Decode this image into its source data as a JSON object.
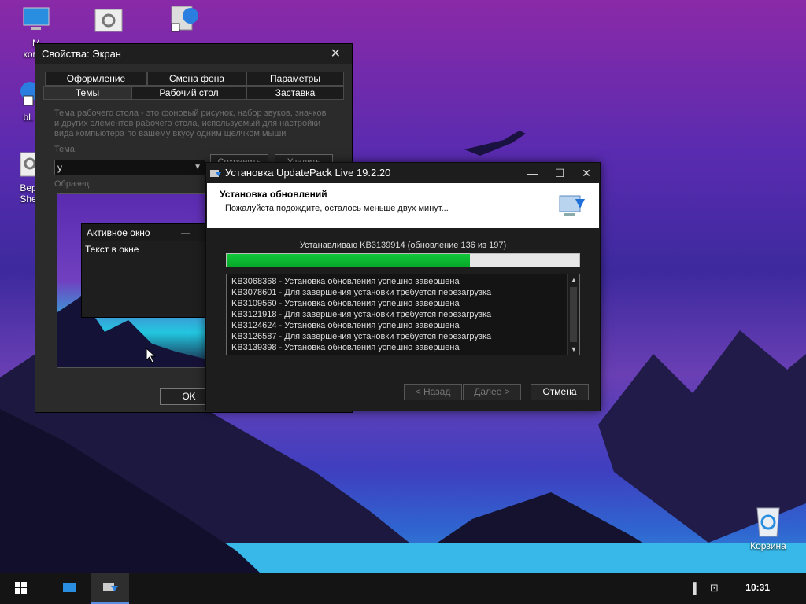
{
  "desktop": {
    "icons": [
      {
        "label_line1": "М",
        "label_line2": "компь"
      },
      {
        "label_line1": "",
        "label_line2": ""
      },
      {
        "label_line1": "",
        "label_line2": ""
      },
      {
        "label_line1": "bL",
        "label_line2": ""
      },
      {
        "label_line1": "Вер",
        "label_line2": "She"
      }
    ],
    "recycle_bin": {
      "label": "Корзина"
    }
  },
  "props_window": {
    "title": "Свойства: Экран",
    "tabs_row1": [
      "Оформление",
      "Смена фона",
      "Параметры"
    ],
    "tabs_row2": [
      "Темы",
      "Рабочий стол",
      "Заставка"
    ],
    "description": "Тема рабочего стола - это фоновый рисунок, набор звуков, значков и других элементов рабочего стола, используемый для настройки вида компьютера по вашему вкусу одним щелчком мыши",
    "theme_label": "Тема:",
    "theme_value": "у",
    "save_label": "Сохранить",
    "delete_label": "Удалить",
    "sample_label": "Образец:",
    "active_window_title": "Активное окно",
    "active_window_text": "Текст в окне",
    "ok_label": "OK"
  },
  "installer": {
    "title": "Установка UpdatePack Live 19.2.20",
    "header_title": "Установка обновлений",
    "header_subtitle": "Пожалуйста подождите, осталось меньше двух минут...",
    "status": "Устанавливаю KB3139914 (обновление 136 из 197)",
    "progress_fraction": 0.69,
    "log": [
      "KB3068368 - Установка обновления успешно завершена",
      "KB3078601 - Для завершения установки требуется перезагрузка",
      "KB3109560 - Установка обновления успешно завершена",
      "KB3121918 - Для завершения установки требуется перезагрузка",
      "KB3124624 - Установка обновления успешно завершена",
      "KB3126587 - Для завершения установки требуется перезагрузка",
      "KB3139398 - Установка обновления успешно завершена"
    ],
    "buttons": {
      "back": "< Назад",
      "next": "Далее >",
      "cancel": "Отмена"
    }
  },
  "taskbar": {
    "clock": "10:31"
  },
  "colors": {
    "progress_green": "#0fbd35",
    "accent": "#5b8ee0"
  }
}
